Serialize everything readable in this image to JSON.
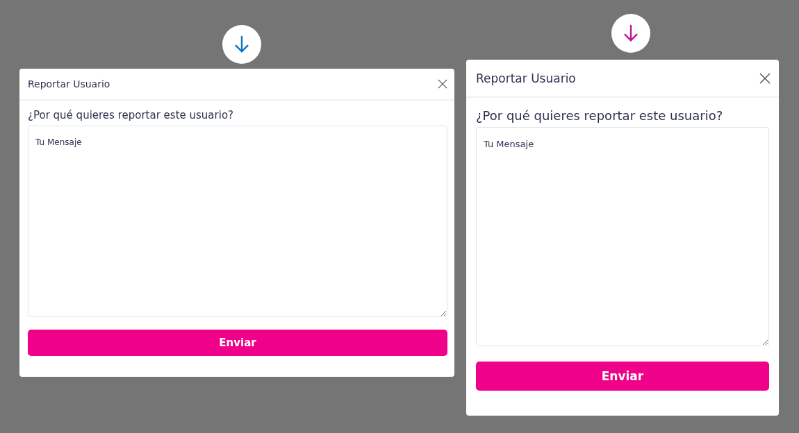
{
  "dialogs": [
    {
      "color": "#0f74c0",
      "title": "Reportar Usuario",
      "question": "¿Por qué quieres reportar este usuario?",
      "placeholder": "Tu Mensaje",
      "button": "Enviar"
    },
    {
      "color": "#c0158f",
      "title": "Reportar Usuario",
      "question": "¿Por qué quieres reportar este usuario?",
      "placeholder": "Tu Mensaje",
      "button": "Enviar"
    }
  ]
}
